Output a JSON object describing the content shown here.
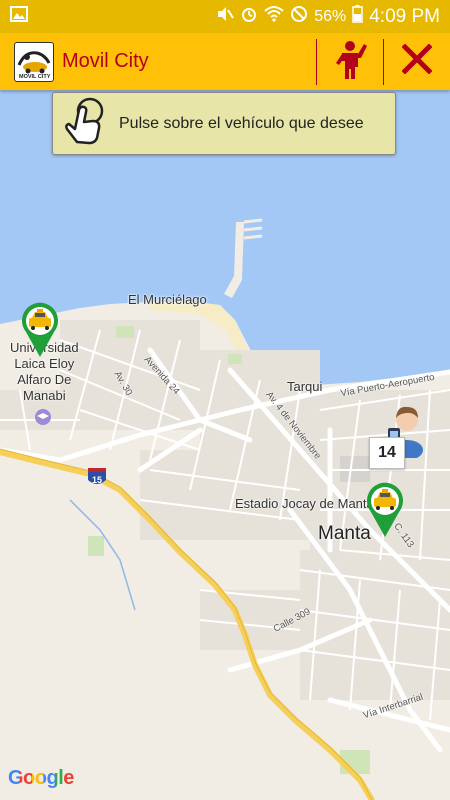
{
  "status_bar": {
    "battery": "56%",
    "time": "4:09 PM"
  },
  "app_bar": {
    "title": "Movil City",
    "logo_text": "MOVIL CITY"
  },
  "hint": {
    "text": "Pulse sobre el vehículo que desee"
  },
  "map": {
    "labels": {
      "murcielago": "El Murciélago",
      "universidad": "Universidad\nLaica Eloy\nAlfaro De\nManabi",
      "tarqui": "Tarqui",
      "estadio": "Estadio Jocay de Manta",
      "manta": "Manta",
      "avenida24": "Avenida 24",
      "av30": "Av. 30",
      "av4nov": "Av. 4 de Noviembre",
      "viapuerto": "Vía Puerto-Aeropuerto",
      "calle309": "Calle 309",
      "viainterbarrial": "Vía Interbarrial",
      "calle113": "C. 113",
      "highway": "15"
    },
    "badge_count": "14",
    "attribution": "Google"
  },
  "colors": {
    "status": "#e6b800",
    "appbar": "#ffc107",
    "accent": "#b3001b",
    "water": "#a4c8f5",
    "pin": "#1f9e3a"
  }
}
